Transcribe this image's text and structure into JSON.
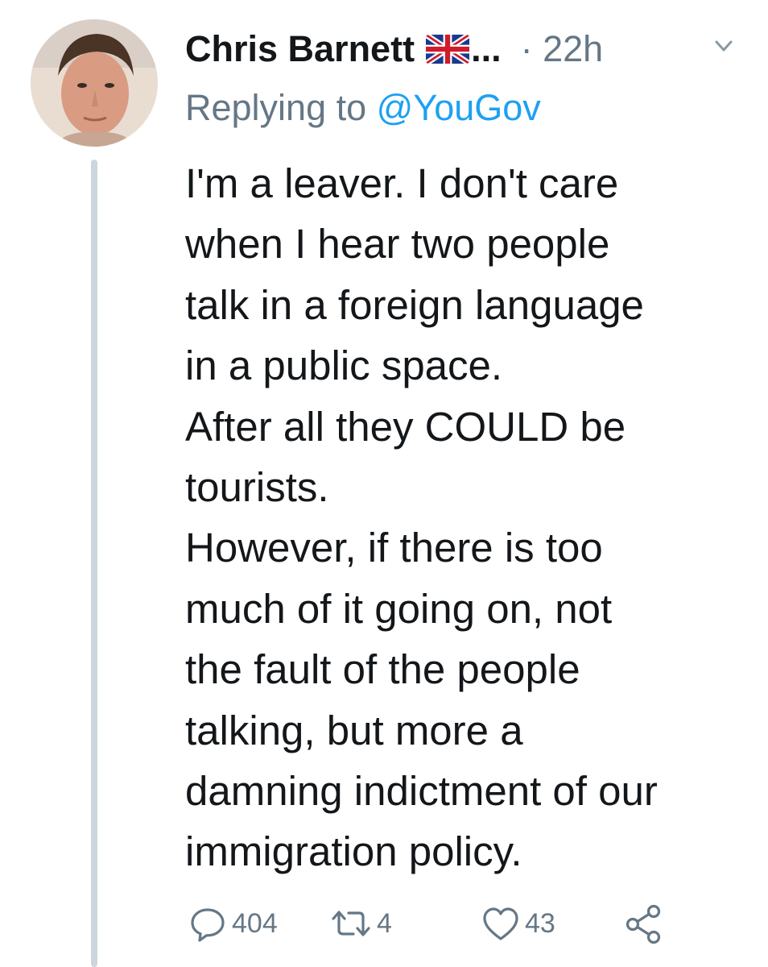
{
  "tweet": {
    "author_name": "Chris Barnett",
    "name_truncation": "...",
    "time_separator": "·",
    "timestamp": "22h",
    "reply_prefix": "Replying to",
    "reply_handle": "@YouGov",
    "text_lines": [
      "I'm a leaver. I don't care",
      "when I hear two people",
      "talk in a foreign language",
      "in a public space.",
      "After all they COULD be",
      "tourists.",
      "However, if there is too",
      "much of it going on, not",
      "the fault of the people",
      "talking, but more a",
      "damning indictment of our",
      "immigration policy."
    ],
    "actions": {
      "replies": "404",
      "retweets": "4",
      "likes": "43"
    }
  },
  "icons": {
    "flag": "uk-flag-emoji",
    "menu": "chevron-down-icon",
    "reply": "reply-icon",
    "retweet": "retweet-icon",
    "like": "heart-icon",
    "share": "share-icon"
  },
  "colors": {
    "text_primary": "#14171a",
    "text_secondary": "#657786",
    "link": "#1da1f2",
    "thread_line": "#ccd6dd",
    "background": "#ffffff"
  }
}
